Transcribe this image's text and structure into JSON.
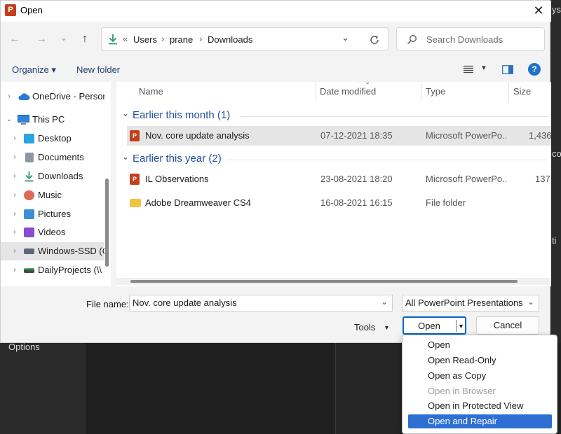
{
  "window": {
    "title": "Open",
    "close_glyph": "✕"
  },
  "background_app": {
    "options_label": "Options",
    "edge_texts": [
      "ysi",
      "co",
      "ti"
    ]
  },
  "nav": {
    "back_glyph": "←",
    "forward_glyph": "→",
    "recent_glyph": "⌄",
    "up_glyph": "↑",
    "breadcrumb": [
      "Users",
      "prane",
      "Downloads"
    ],
    "overflow_glyph": "«",
    "search_placeholder": "Search Downloads"
  },
  "toolbar": {
    "organize_label": "Organize ▾",
    "new_folder_label": "New folder",
    "help_glyph": "?"
  },
  "sidebar": {
    "items": [
      {
        "label": "OneDrive - Person",
        "chevron": "›",
        "icon": "cloud-icon",
        "color": "#2b7bd6"
      },
      {
        "label": "This PC",
        "chevron": "⌄",
        "icon": "monitor-icon",
        "color": "#2f86d8"
      },
      {
        "label": "Desktop",
        "chevron": "›",
        "icon": "desktop-icon",
        "color": "#2aa3e0"
      },
      {
        "label": "Documents",
        "chevron": "›",
        "icon": "documents-icon",
        "color": "#8a98a8"
      },
      {
        "label": "Downloads",
        "chevron": "›",
        "icon": "download-icon",
        "color": "#2e9a6a"
      },
      {
        "label": "Music",
        "chevron": "›",
        "icon": "music-icon",
        "color": "#e06b55"
      },
      {
        "label": "Pictures",
        "chevron": "›",
        "icon": "pictures-icon",
        "color": "#3a8fd8"
      },
      {
        "label": "Videos",
        "chevron": "›",
        "icon": "videos-icon",
        "color": "#8a4bd0"
      },
      {
        "label": "Windows-SSD (C",
        "chevron": "›",
        "icon": "drive-icon",
        "color": "#5a6a7a"
      },
      {
        "label": "DailyProjects (\\\\",
        "chevron": "›",
        "icon": "network-drive-icon",
        "color": "#4a4a4a"
      }
    ]
  },
  "filelist": {
    "columns": {
      "name": "Name",
      "date": "Date modified",
      "type": "Type",
      "size": "Size"
    },
    "groups": [
      {
        "label": "Earlier this month (1)"
      },
      {
        "label": "Earlier this year (2)"
      }
    ],
    "rows": [
      {
        "name": "Nov. core update analysis",
        "date": "07-12-2021 18:35",
        "type": "Microsoft PowerPo...",
        "size": "1,436",
        "icon": "powerpoint-icon"
      },
      {
        "name": "IL Observations",
        "date": "23-08-2021 18:20",
        "type": "Microsoft PowerPo...",
        "size": "137",
        "icon": "powerpoint-icon"
      },
      {
        "name": "Adobe Dreamweaver CS4",
        "date": "16-08-2021 16:15",
        "type": "File folder",
        "size": "",
        "icon": "folder-icon"
      }
    ]
  },
  "bottom": {
    "filename_label": "File name:",
    "filename_value": "Nov. core update analysis",
    "filetype_value": "All PowerPoint Presentations",
    "tools_label": "Tools",
    "open_label": "Open",
    "cancel_label": "Cancel"
  },
  "open_menu": {
    "items": [
      {
        "label": "Open"
      },
      {
        "label": "Open Read-Only"
      },
      {
        "label": "Open as Copy"
      },
      {
        "label": "Open in Browser"
      },
      {
        "label": "Open in Protected View"
      },
      {
        "label": "Open and Repair"
      }
    ]
  },
  "colors": {
    "accent": "#0067c0",
    "group_heading": "#1f4e9c",
    "selected_row": "#e5e5e5",
    "highlight": "#2f6ed3",
    "disabled": "#a0a0a0"
  }
}
